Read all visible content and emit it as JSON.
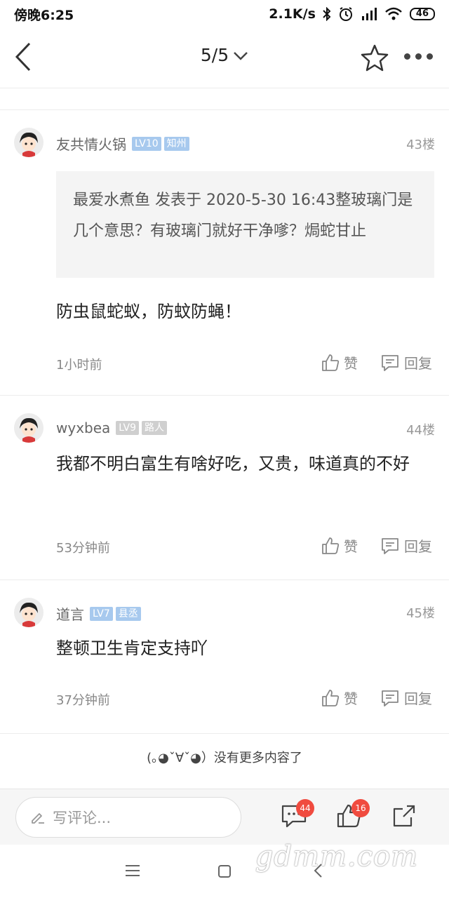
{
  "status_bar": {
    "time": "傍晚6:25",
    "net_speed": "2.1K/s",
    "battery": "46"
  },
  "header": {
    "page_indicator": "5/5"
  },
  "comments": [
    {
      "username": "友共情火锅",
      "level": "LV10",
      "role": "知州",
      "floor": "43楼",
      "quote": "最爱水煮鱼 发表于 2020-5-30 16:43整玻璃门是几个意思？有玻璃门就好干净嗲？焗蛇甘止",
      "text": "防虫鼠蛇蚁，防蚊防蝇！",
      "time": "1小时前",
      "like_label": "赞",
      "reply_label": "回复"
    },
    {
      "username": "wyxbea",
      "level": "LV9",
      "role": "路人",
      "floor": "44楼",
      "text": "我都不明白富生有啥好吃，又贵，味道真的不好",
      "time": "53分钟前",
      "like_label": "赞",
      "reply_label": "回复"
    },
    {
      "username": "道言",
      "level": "LV7",
      "role": "县丞",
      "floor": "45楼",
      "text": "整顿卫生肯定支持吖",
      "time": "37分钟前",
      "like_label": "赞",
      "reply_label": "回复"
    }
  ],
  "no_more_text": "(｡◕ˇ∀ˇ◕）没有更多内容了",
  "bottom_bar": {
    "write_placeholder": "写评论...",
    "comment_count": "44",
    "like_count": "16"
  },
  "watermark": "gdmm.com",
  "colors": {
    "badge_blue": "#a7c9ee",
    "badge_gray": "#cfcfcf",
    "badge_red": "#f04b3f"
  }
}
